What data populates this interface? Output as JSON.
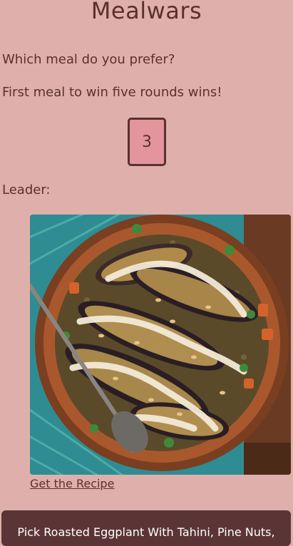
{
  "app": {
    "title": "Mealwars"
  },
  "game": {
    "prompt": "Which meal do you prefer?",
    "rule": "First meal to win five rounds wins!",
    "round": "3",
    "leader_label": "Leader:"
  },
  "meal": {
    "photo_alt": "Roasted Eggplant With Tahini, Pine Nuts",
    "recipe_link": "Get the Recipe",
    "pick_label": "Pick Roasted Eggplant With Tahini, Pine Nuts,"
  }
}
